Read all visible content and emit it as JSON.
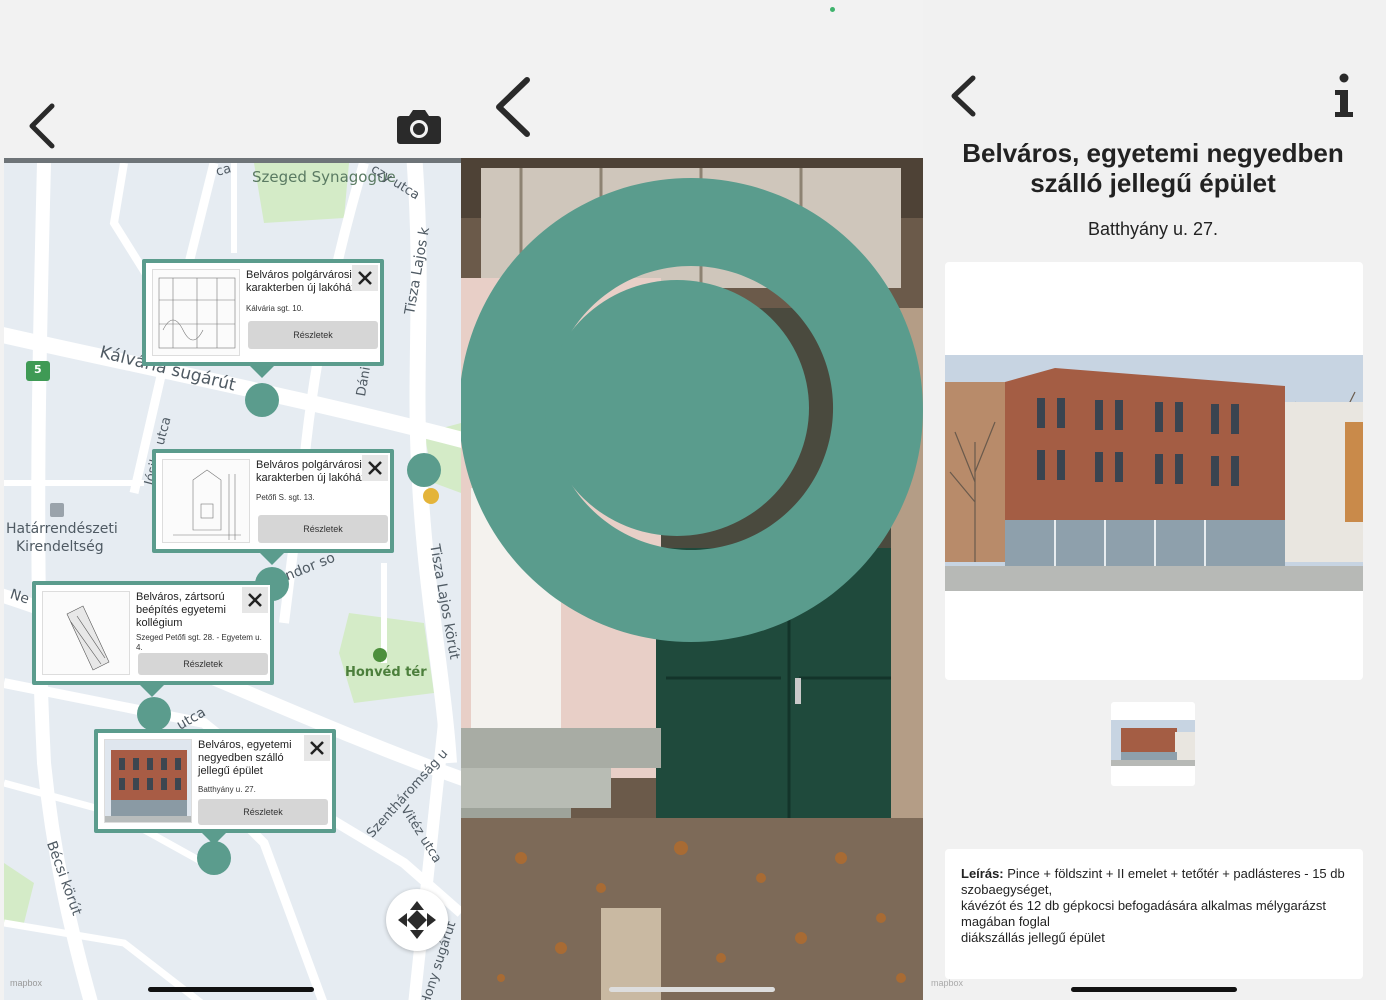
{
  "colors": {
    "accent": "#5b9c8d",
    "background": "#f2f2f2",
    "map_background": "#e6ecf2"
  },
  "map_screen": {
    "icons": {
      "back": "chevron-left-icon",
      "camera": "camera-icon",
      "recenter": "move-arrows-icon"
    },
    "map_labels": {
      "synagogue": "Szeged Synagogue",
      "kalvaria": "Kálvária sugárút",
      "hatarrendeszeti_1": "Határrendészeti",
      "hatarrendeszeti_2": "Kirendeltség",
      "honved": "Honvéd tér",
      "tisza_1": "Tisza Lajos k",
      "tisza_2": "Tisza Lajos körút",
      "josika": "Jósika utca",
      "dani": "Dáni",
      "becsi": "Bécsi körút",
      "szentharomsag": "Szentháromság u",
      "viteez": "Vitéz utca",
      "hony": "Hony sugárút",
      "ca": "ca",
      "ocy": "czy utca",
      "ndor": "ndor so",
      "utca2": "utca",
      "ne": "Ne",
      "badge": "5",
      "mapbox": "mapbox"
    },
    "cards": [
      {
        "title": "Belváros polgárvárosi karakterben új lakóház",
        "address": "Kálvária sgt. 10.",
        "button": "Részletek"
      },
      {
        "title": "Belváros polgárvárosi karakterben új lakóház",
        "address": "Petőfi S. sgt. 13.",
        "button": "Részletek"
      },
      {
        "title": "Belváros, zártsorú beépítés egyetemi kollégium",
        "address": "Szeged Petőfi sgt. 28. - Egyetem u. 4.",
        "button": "Részletek"
      },
      {
        "title": "Belváros, egyetemi negyedben szálló jellegű épület",
        "address": "Batthyány u. 27.",
        "button": "Részletek"
      }
    ]
  },
  "ar_screen": {
    "icons": {
      "back": "chevron-left-icon",
      "target": "ar-target-ring"
    }
  },
  "detail_screen": {
    "icons": {
      "back": "chevron-left-icon",
      "info": "info-icon"
    },
    "title": "Belváros, egyetemi negyedben szálló jellegű épület",
    "address": "Batthyány u. 27.",
    "description_label": "Leírás:",
    "description_lines": [
      " Pince + földszint + II emelet + tetőtér + padlásteres - 15 db szobaegységet,",
      "kávézót és 12 db gépkocsi befogadására alkalmas mélygarázst magában foglal",
      "diákszállás jellegű épület"
    ],
    "mapbox": "mapbox"
  }
}
